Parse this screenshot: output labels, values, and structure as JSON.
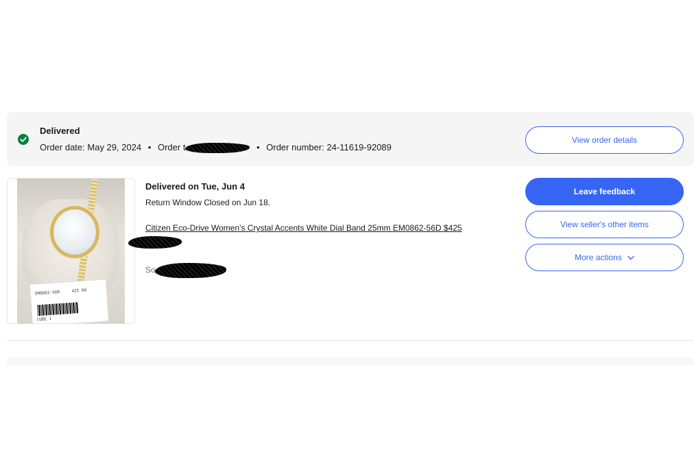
{
  "order": {
    "status": "Delivered",
    "date_label": "Order date:",
    "date_value": "May 29, 2024",
    "total_label": "Order t",
    "number_label": "Order number:",
    "number_value": "24-11619-92089",
    "view_details_label": "View order details"
  },
  "item": {
    "delivered_on": "Delivered on Tue, Jun 4",
    "return_window": "Return Window Closed on Jun 18.",
    "title": "Citizen Eco-Drive Women's Crystal Accents White Dial Band 25mm EM0862-56D $425",
    "sold_by_prefix": "So",
    "tag_sku": "EM0862-56B",
    "tag_price": "425 00",
    "tag_model": "CUBE 1"
  },
  "actions": {
    "leave_feedback": "Leave feedback",
    "view_seller_items": "View seller's other items",
    "more_actions": "More actions"
  },
  "icons": {
    "status": "check-circle-icon",
    "more_actions": "chevron-down-icon"
  },
  "colors": {
    "accent": "#3665f3",
    "success": "#05823f",
    "header_bg": "#f5f5f5"
  }
}
